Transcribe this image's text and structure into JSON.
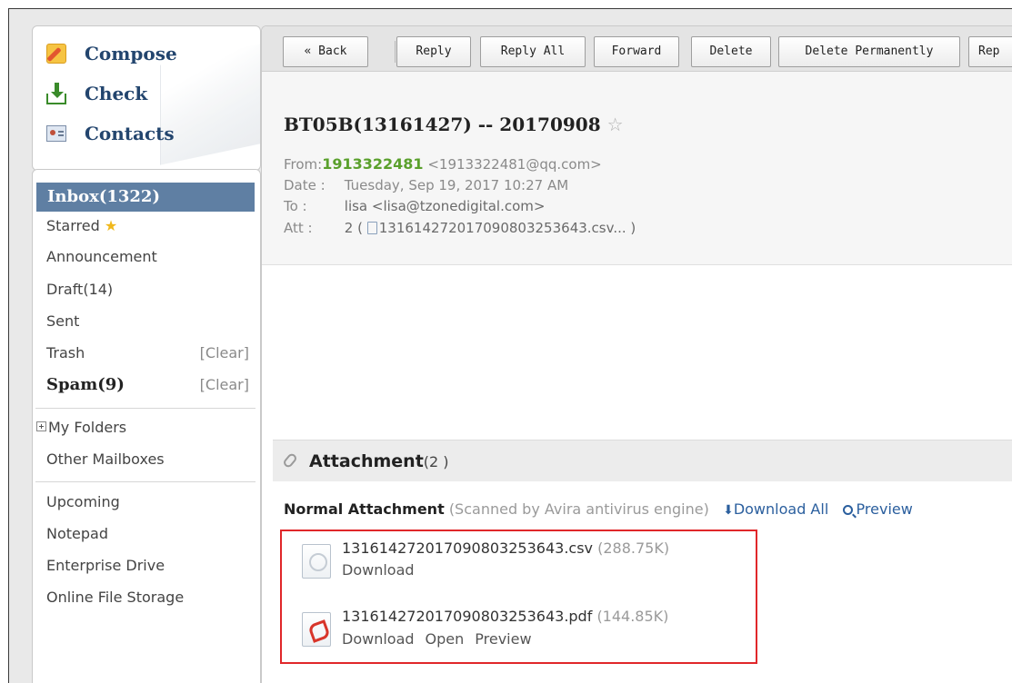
{
  "quick_actions": {
    "compose": "Compose",
    "check": "Check",
    "contacts": "Contacts"
  },
  "folders": {
    "inbox": "Inbox(1322)",
    "starred": "Starred",
    "announcement": "Announcement",
    "draft": "Draft(14)",
    "sent": "Sent",
    "trash": "Trash",
    "trash_clear": "[Clear]",
    "spam": "Spam(9)",
    "spam_clear": "[Clear]",
    "my_folders": "My Folders",
    "other_mailboxes": "Other Mailboxes",
    "upcoming": "Upcoming",
    "notepad": "Notepad",
    "enterprise_drive": "Enterprise Drive",
    "online_file_storage": "Online File Storage"
  },
  "toolbar": {
    "back": "« Back",
    "reply": "Reply",
    "reply_all": "Reply All",
    "forward": "Forward",
    "delete": "Delete",
    "delete_permanently": "Delete Permanently",
    "report": "Rep"
  },
  "message": {
    "subject": "BT05B(13161427) -- 20170908",
    "from_label": "From:",
    "from_name": "1913322481",
    "from_email": "<1913322481@qq.com>",
    "date_label": "Date :",
    "date_value": "Tuesday, Sep 19, 2017 10:27 AM",
    "to_label": "To :",
    "to_value": "lisa <lisa@tzonedigital.com>",
    "att_label": "Att :",
    "att_count": "2",
    "att_summary": "13161427201709080325364​3.csv... )"
  },
  "attachments": {
    "title": "Attachment",
    "count": "(2 )",
    "normal_title": "Normal Attachment",
    "scan_note": "(Scanned by Avira antivirus engine)",
    "download_all": "Download All",
    "preview": "Preview",
    "files": [
      {
        "name": "13161427201709080325364​3.csv",
        "size": "(288.75K)",
        "download": "Download"
      },
      {
        "name": "13161427201709080325364​3.pdf",
        "size": "(144.85K)",
        "download": "Download",
        "open": "Open",
        "preview": "Preview"
      }
    ]
  },
  "colors": {
    "inbox_bg": "#5f7fa3",
    "from_name": "#5aa02c",
    "link": "#2b5f9e",
    "highlight_box": "#e0272a",
    "star": "#f0b81c"
  }
}
